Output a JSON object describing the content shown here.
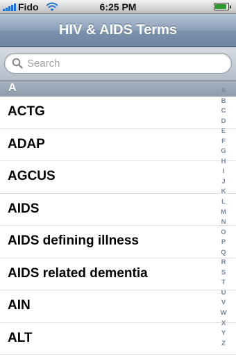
{
  "status_bar": {
    "carrier": "Fido",
    "time": "6:25 PM",
    "battery_level": 0.9
  },
  "nav": {
    "title": "HIV & AIDS Terms"
  },
  "search": {
    "placeholder": "Search",
    "value": ""
  },
  "section": {
    "header": "A"
  },
  "items": [
    {
      "label": "ACTG"
    },
    {
      "label": "ADAP"
    },
    {
      "label": "AGCUS"
    },
    {
      "label": "AIDS"
    },
    {
      "label": "AIDS defining illness"
    },
    {
      "label": "AIDS related dementia"
    },
    {
      "label": "AIN"
    },
    {
      "label": "ALT"
    }
  ],
  "index_letters": [
    "A",
    "B",
    "C",
    "D",
    "E",
    "F",
    "G",
    "H",
    "I",
    "J",
    "K",
    "L",
    "M",
    "N",
    "O",
    "P",
    "Q",
    "R",
    "S",
    "T",
    "U",
    "V",
    "W",
    "X",
    "Y",
    "Z"
  ],
  "colors": {
    "nav_bar": "#7d92ae",
    "section_header": "#99a5b4",
    "signal": "#1e6fd0",
    "battery": "#2d9a2d"
  },
  "icons": {
    "signal": "signal-bars-icon",
    "wifi": "wifi-icon",
    "battery": "battery-icon",
    "search": "search-icon"
  }
}
